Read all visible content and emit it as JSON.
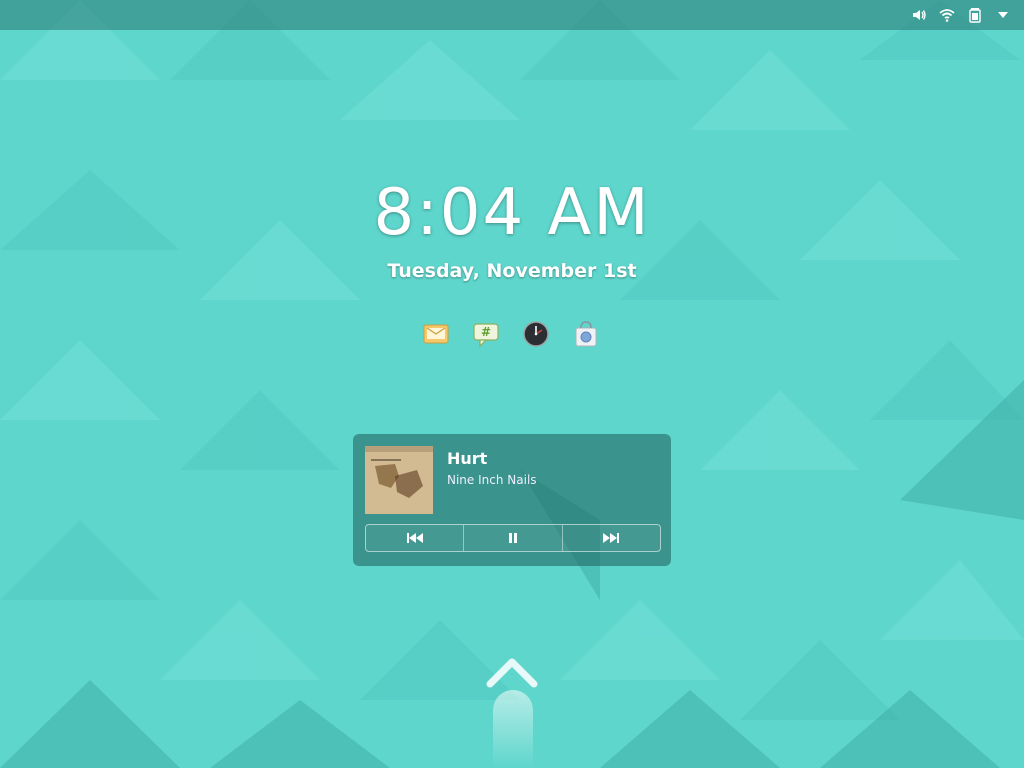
{
  "lock_screen": {
    "time": "8:04 AM",
    "date": "Tuesday, November 1st"
  },
  "status_bar": {
    "icons": [
      "volume-icon",
      "wifi-icon",
      "battery-icon",
      "menu-arrow-icon"
    ]
  },
  "notifications": {
    "icons": [
      "mail-icon",
      "chat-icon",
      "clock-icon",
      "software-store-icon"
    ]
  },
  "media_player": {
    "title": "Hurt",
    "artist": "Nine Inch Nails",
    "controls": [
      "previous-icon",
      "pause-icon",
      "next-icon"
    ]
  },
  "colors": {
    "background": "#5ed6cc",
    "topbar": "#2e7a74",
    "card": "#2a6d68"
  }
}
